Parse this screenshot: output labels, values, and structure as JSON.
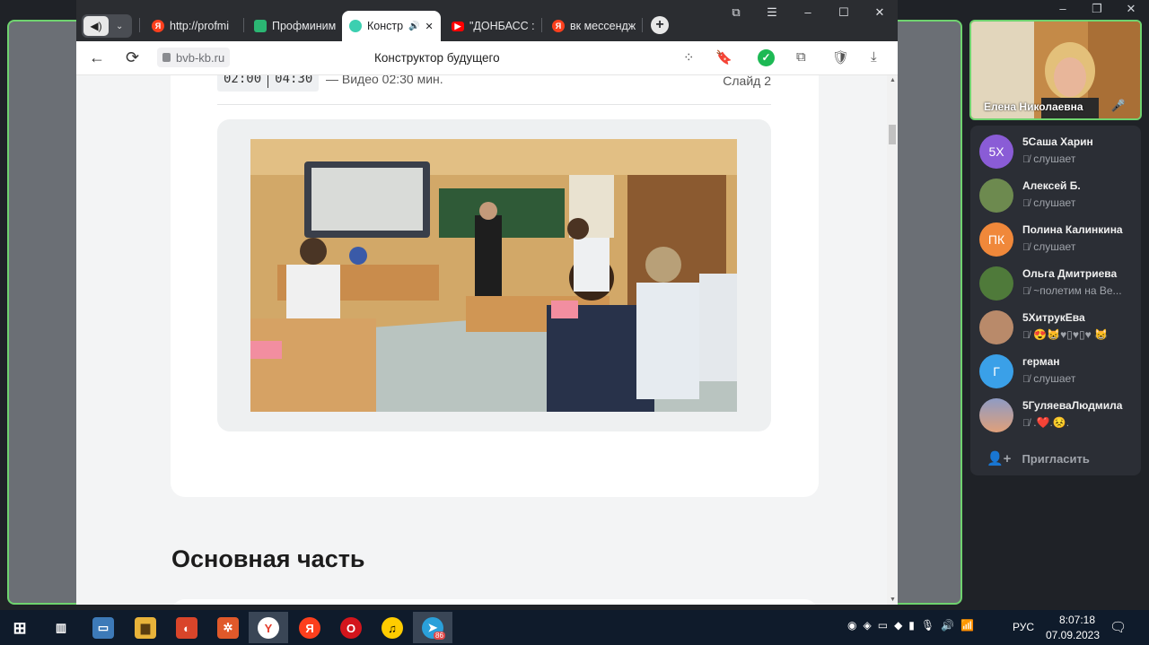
{
  "call_window": {
    "controls": [
      "–",
      "❐",
      "✕"
    ]
  },
  "browser": {
    "audio_button_icon": "speaker-icon",
    "tabs": [
      {
        "label": "http://profmi",
        "favicon": "yandex-icon",
        "active": false
      },
      {
        "label": "Профминим",
        "favicon": "green-app-icon",
        "active": false
      },
      {
        "label": "Констр",
        "favicon": "teal-app-icon",
        "active": true,
        "audio": "🔊",
        "close": "✕"
      },
      {
        "label": "\"ДОНБАСС :",
        "favicon": "youtube-icon",
        "active": false
      },
      {
        "label": "вк мессендж",
        "favicon": "yandex-icon",
        "active": false
      }
    ],
    "new_tab": "+",
    "window_controls": [
      "⧉",
      "☰",
      "–",
      "☐",
      "✕"
    ],
    "url": "bvb-kb.ru",
    "page_title": "Конструктор будущего",
    "nav": {
      "back": "←",
      "reload": "⟳"
    },
    "toolbar_icons": [
      "extensions-icon",
      "bookmark-icon",
      "check-icon",
      "copy-icon",
      "shield-icon",
      "download-icon"
    ]
  },
  "page": {
    "timer_start": "02:00",
    "timer_end": "04:30",
    "video_note": "— Видео 02:30 мин.",
    "slide_label": "Слайд 2",
    "section_heading": "Основная часть"
  },
  "speaker": {
    "name": "Елена Николаевна",
    "mic": "🎤"
  },
  "participants": [
    {
      "name": "5Саша Харин",
      "status": "слушает",
      "initials": "5Х",
      "color": "#8a5cd6"
    },
    {
      "name": "Алексей Б.",
      "status": "слушает",
      "initials": "",
      "color": "#6d8a4f"
    },
    {
      "name": "Полина Калинкина",
      "status": "слушает",
      "initials": "ПК",
      "color": "#f0883a"
    },
    {
      "name": "Ольга Дмитриева",
      "status": "~полетим на Ве...",
      "initials": "",
      "color": "#4f7a3a"
    },
    {
      "name": "5ХитрукЕва",
      "status": "😍😸♥▯♥▯♥ 😸",
      "initials": "",
      "color": "#b98a6a"
    },
    {
      "name": "герман",
      "status": "слушает",
      "initials": "Г",
      "color": "#3aa0e8"
    },
    {
      "name": "5ГуляеваЛюдмила",
      "status": ".❤️.😣.",
      "initials": "",
      "color": "#c98a8a"
    }
  ],
  "invite_label": "Пригласить",
  "taskbar": {
    "language": "РУС",
    "time": "8:07:18",
    "date": "07.09.2023",
    "telegram_badge": "86"
  }
}
